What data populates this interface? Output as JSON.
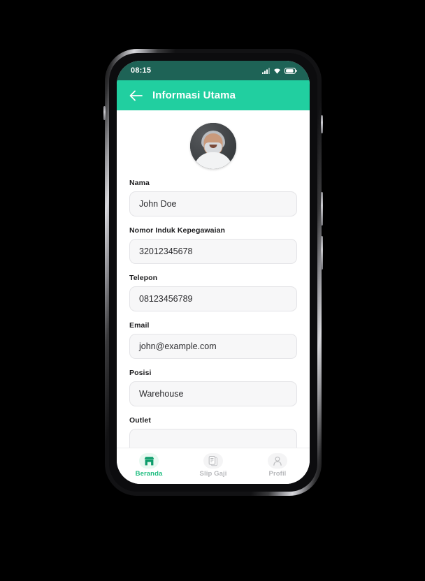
{
  "theme": {
    "status_bar_bg": "#1e6356",
    "app_bar_bg": "#21cfa0",
    "accent_green": "#1fbd80",
    "input_bg": "#f7f7f8",
    "input_border": "#e4e4e7",
    "page_bg": "#ffffff",
    "inactive_gray": "#b7b8bb"
  },
  "status_bar": {
    "time": "08:15",
    "icons": [
      "signal-icon",
      "wifi-icon",
      "battery-icon"
    ]
  },
  "app_bar": {
    "back_icon": "arrow-left-icon",
    "title": "Informasi Utama"
  },
  "profile": {
    "avatar_alt": "profile-photo"
  },
  "form": {
    "fields": [
      {
        "label": "Nama",
        "value": "John Doe",
        "name": "nama"
      },
      {
        "label": "Nomor Induk Kepegawaian",
        "value": "32012345678",
        "name": "nomor-induk-kepegawaian"
      },
      {
        "label": "Telepon",
        "value": "08123456789",
        "name": "telepon"
      },
      {
        "label": "Email",
        "value": "john@example.com",
        "name": "email"
      },
      {
        "label": "Posisi",
        "value": "Warehouse",
        "name": "posisi"
      },
      {
        "label": "Outlet",
        "value": "",
        "name": "outlet"
      }
    ]
  },
  "bottom_nav": {
    "items": [
      {
        "label": "Beranda",
        "icon": "home-store-icon",
        "active": true
      },
      {
        "label": "Slip Gaji",
        "icon": "document-icon",
        "active": false
      },
      {
        "label": "Profil",
        "icon": "person-icon",
        "active": false
      }
    ]
  }
}
